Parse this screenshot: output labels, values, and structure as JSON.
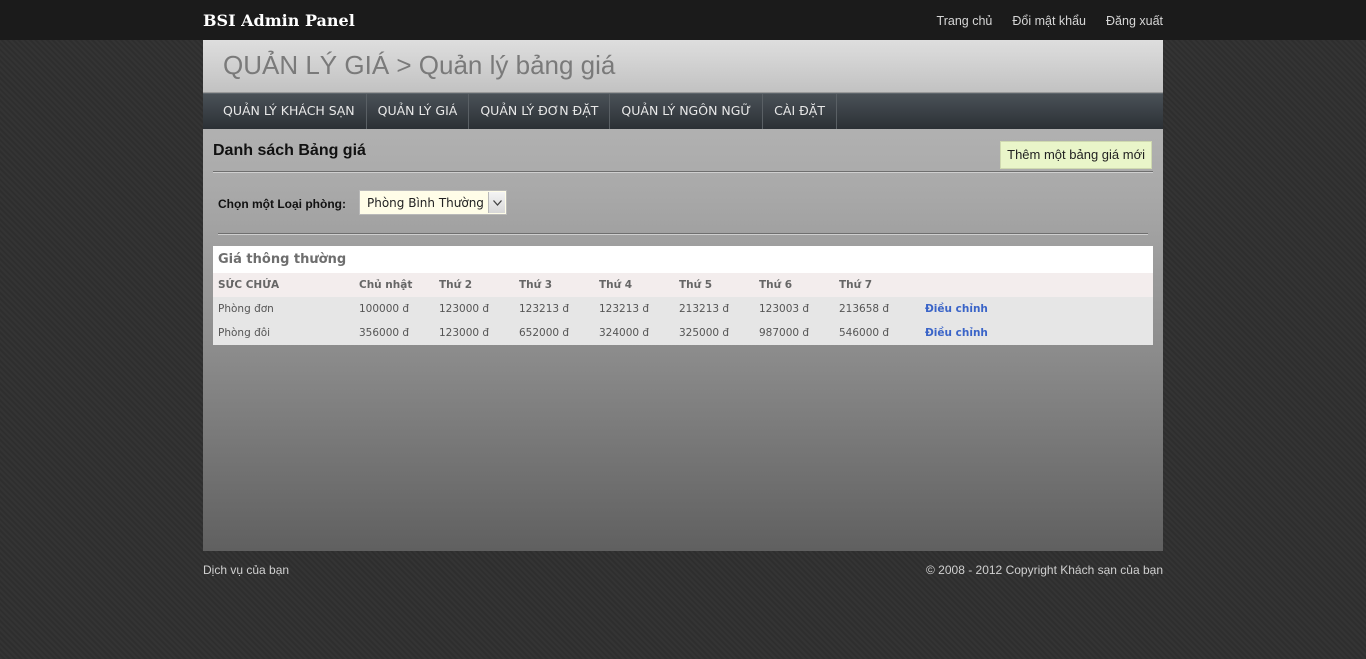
{
  "topbar": {
    "brand": "BSI Admin Panel",
    "links": [
      "Trang chủ",
      "Đổi mật khẩu",
      "Đăng xuất"
    ]
  },
  "header": {
    "title": "QUẢN LÝ GIÁ > Quản lý bảng giá"
  },
  "nav": {
    "items": [
      "QUẢN LÝ KHÁCH SẠN",
      "QUẢN LÝ GIÁ",
      "QUẢN LÝ ĐƠN ĐẶT",
      "QUẢN LÝ NGÔN NGỮ",
      "CÀI ĐẶT"
    ]
  },
  "content": {
    "title": "Danh sách Bảng giá",
    "add_button": "Thêm một bảng giá mới",
    "room_type_label": "Chọn một Loại phòng:",
    "room_type_selected": "Phòng Bình Thường"
  },
  "price_table": {
    "title": "Giá thông thường",
    "columns": [
      "SỨC CHỨA",
      "Chủ nhật",
      "Thứ 2",
      "Thứ 3",
      "Thứ 4",
      "Thứ 5",
      "Thứ 6",
      "Thứ 7"
    ],
    "rows": [
      {
        "name": "Phòng đơn",
        "prices": [
          "100000 đ",
          "123000 đ",
          "123213 đ",
          "123213 đ",
          "213213 đ",
          "123003 đ",
          "213658 đ"
        ],
        "action": "Điều chỉnh"
      },
      {
        "name": "Phòng đôi",
        "prices": [
          "356000 đ",
          "123000 đ",
          "652000 đ",
          "324000 đ",
          "325000 đ",
          "987000 đ",
          "546000 đ"
        ],
        "action": "Điều chỉnh"
      }
    ]
  },
  "footer": {
    "left": "Dịch vụ của bạn",
    "right": "© 2008 - 2012 Copyright Khách sạn của bạn"
  }
}
